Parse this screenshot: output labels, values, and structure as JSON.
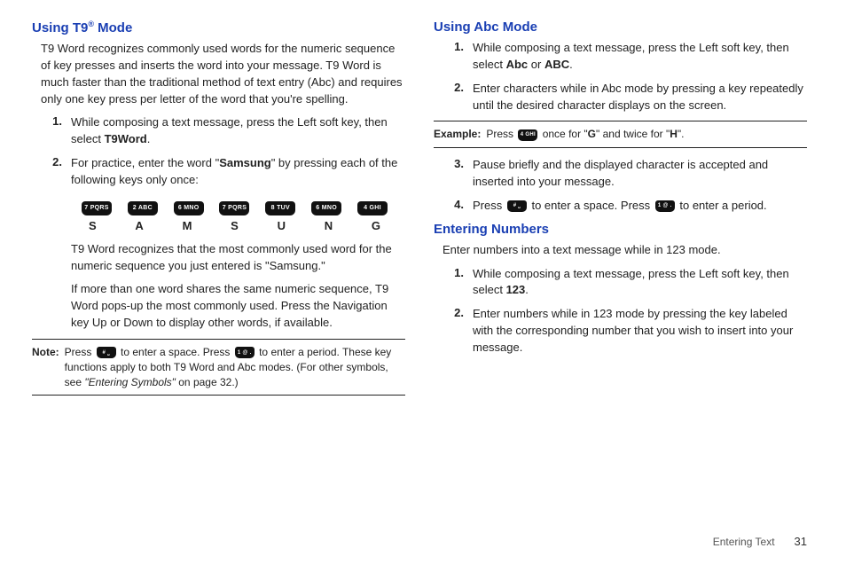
{
  "left": {
    "h_pre": "Using T9",
    "h_reg": "®",
    "h_post": " Mode",
    "intro": "T9 Word recognizes commonly used words for the numeric sequence of key presses and inserts the word into your message. T9 Word is much faster than the traditional method of text entry (Abc) and requires only one key press per letter of the word that you're spelling.",
    "s1_a": "While composing a text message, press the Left soft key, then select ",
    "s1_b": "T9Word",
    "s1_c": ".",
    "s2_a": "For practice, enter the word \"",
    "s2_b": "Samsung",
    "s2_c": "\" by pressing each of the following keys only once:",
    "keys": [
      "7 PQRS",
      "2 ABC",
      "6 MNO",
      "7 PQRS",
      "8 TUV",
      "6 MNO",
      "4 GHI"
    ],
    "letters": [
      "S",
      "A",
      "M",
      "S",
      "U",
      "N",
      "G"
    ],
    "sub1": "T9 Word recognizes that the most commonly used word for the numeric sequence you just entered is \"Samsung.\"",
    "sub2": "If more than one word shares the same numeric sequence, T9 Word pops-up the most commonly used. Press the Navigation key Up or Down to display other words, if available.",
    "note_label": "Note:",
    "note_a": "Press ",
    "note_key1": "# ⎵",
    "note_b": " to enter a space. Press ",
    "note_key2": "1 @ .",
    "note_c": " to enter a period. These key functions apply to both T9 Word and Abc modes. (For other symbols, see ",
    "note_ital": "\"Entering Symbols\"",
    "note_d": " on page 32.)"
  },
  "right": {
    "h1": "Using Abc Mode",
    "s1_a": "While composing a text message, press the Left soft key, then select ",
    "s1_b": "Abc",
    "s1_c": " or ",
    "s1_d": "ABC",
    "s1_e": ".",
    "s2": "Enter characters while in Abc mode by pressing a key repeatedly until the desired character displays on the screen.",
    "ex_label": "Example:",
    "ex_a": "Press ",
    "ex_key": "4 GHI",
    "ex_b": " once for \"",
    "ex_g": "G",
    "ex_c": "\" and twice for \"",
    "ex_h": "H",
    "ex_d": "\".",
    "s3": "Pause briefly and the displayed character is accepted and inserted into your message.",
    "s4_a": "Press ",
    "s4_key1": "# ⎵",
    "s4_b": " to enter a space. Press ",
    "s4_key2": "1 @ .",
    "s4_c": " to enter a period.",
    "h2": "Entering Numbers",
    "intro2": "Enter numbers into a text message while in 123 mode.",
    "n1_a": "While composing a text message, press the Left soft key, then select ",
    "n1_b": "123",
    "n1_c": ".",
    "n2": "Enter numbers while in 123 mode by pressing the key labeled with the corresponding number that you wish to insert into your message."
  },
  "footer": {
    "section": "Entering Text",
    "page": "31"
  }
}
